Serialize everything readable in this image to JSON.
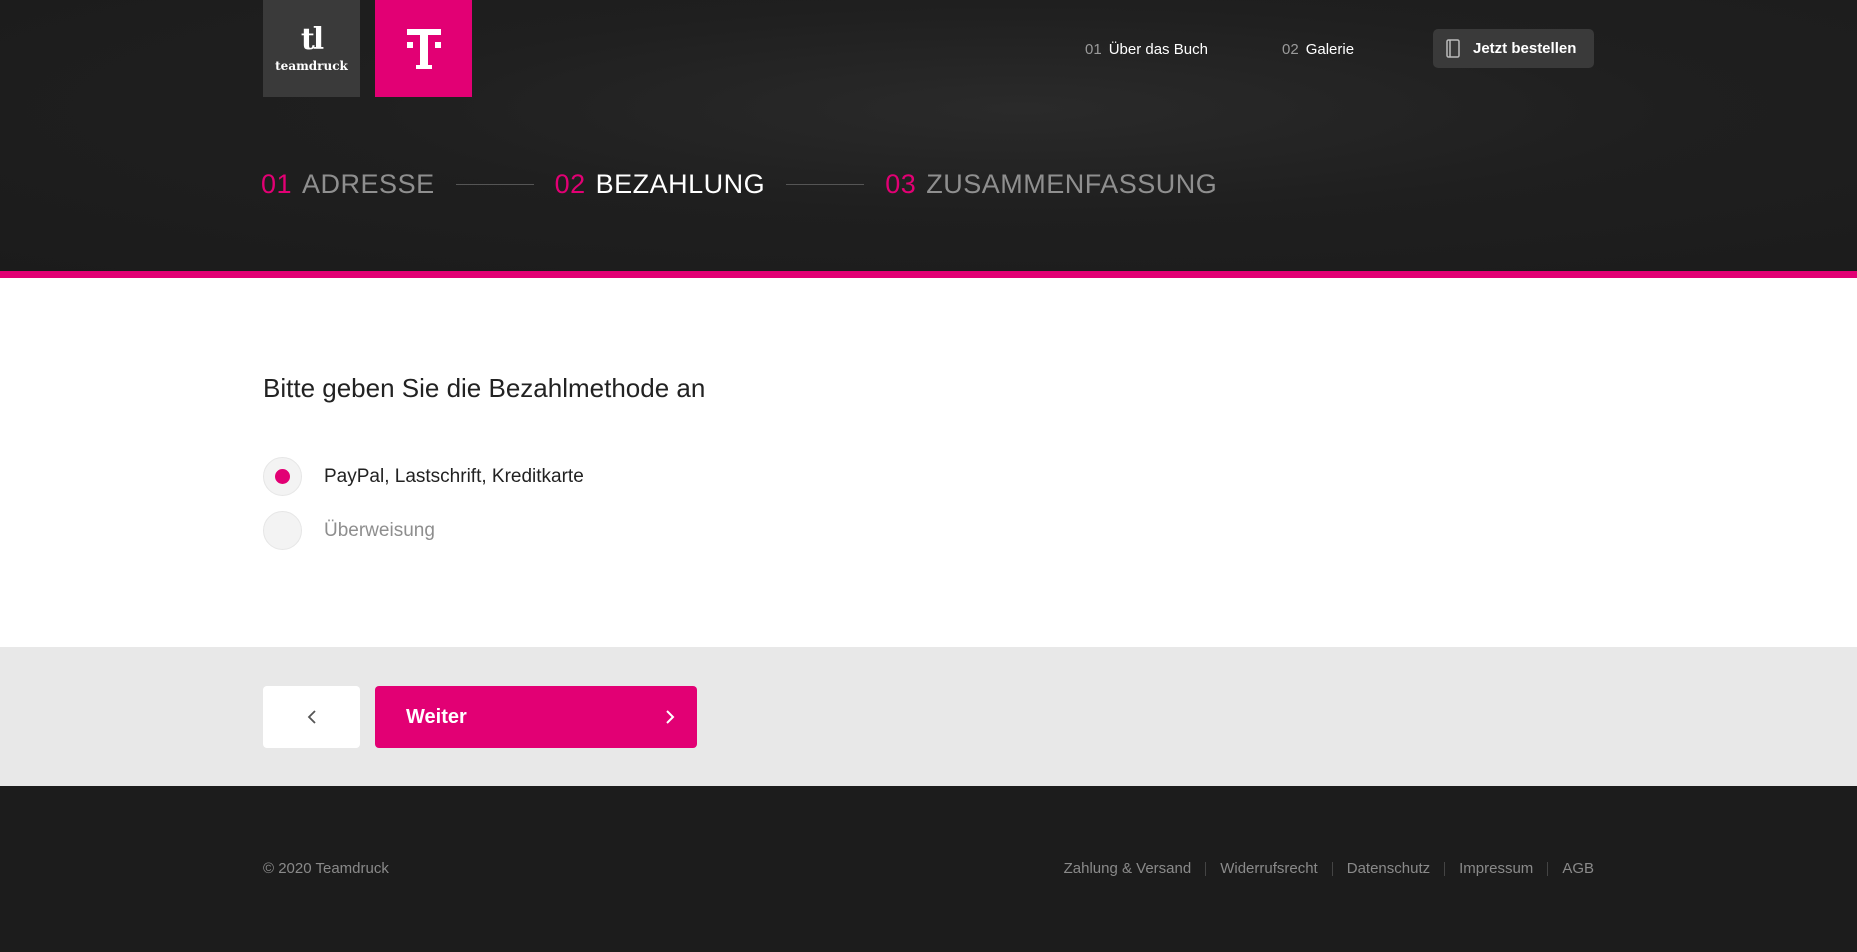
{
  "header": {
    "logo_mark": "tl",
    "logo_word": "teamdruck",
    "nav": [
      {
        "num": "01",
        "label": "Über das Buch"
      },
      {
        "num": "02",
        "label": "Galerie"
      }
    ],
    "order_button": "Jetzt bestellen"
  },
  "steps": [
    {
      "num": "01",
      "label": "ADRESSE"
    },
    {
      "num": "02",
      "label": "BEZAHLUNG"
    },
    {
      "num": "03",
      "label": "ZUSAMMENFASSUNG"
    }
  ],
  "active_step": "BEZAHLUNG",
  "main": {
    "question": "Bitte geben Sie die Bezahlmethode an",
    "options": [
      {
        "label": "PayPal, Lastschrift, Kreditkarte",
        "selected": true
      },
      {
        "label": "Überweisung",
        "selected": false
      }
    ]
  },
  "actions": {
    "next_label": "Weiter"
  },
  "footer": {
    "copyright": "© 2020 Teamdruck",
    "links": [
      "Zahlung & Versand",
      "Widerrufsrecht",
      "Datenschutz",
      "Impressum",
      "AGB"
    ]
  },
  "colors": {
    "accent": "#e20074",
    "header_bg": "#1c1c1c",
    "action_bar_bg": "#e8e8e8"
  }
}
